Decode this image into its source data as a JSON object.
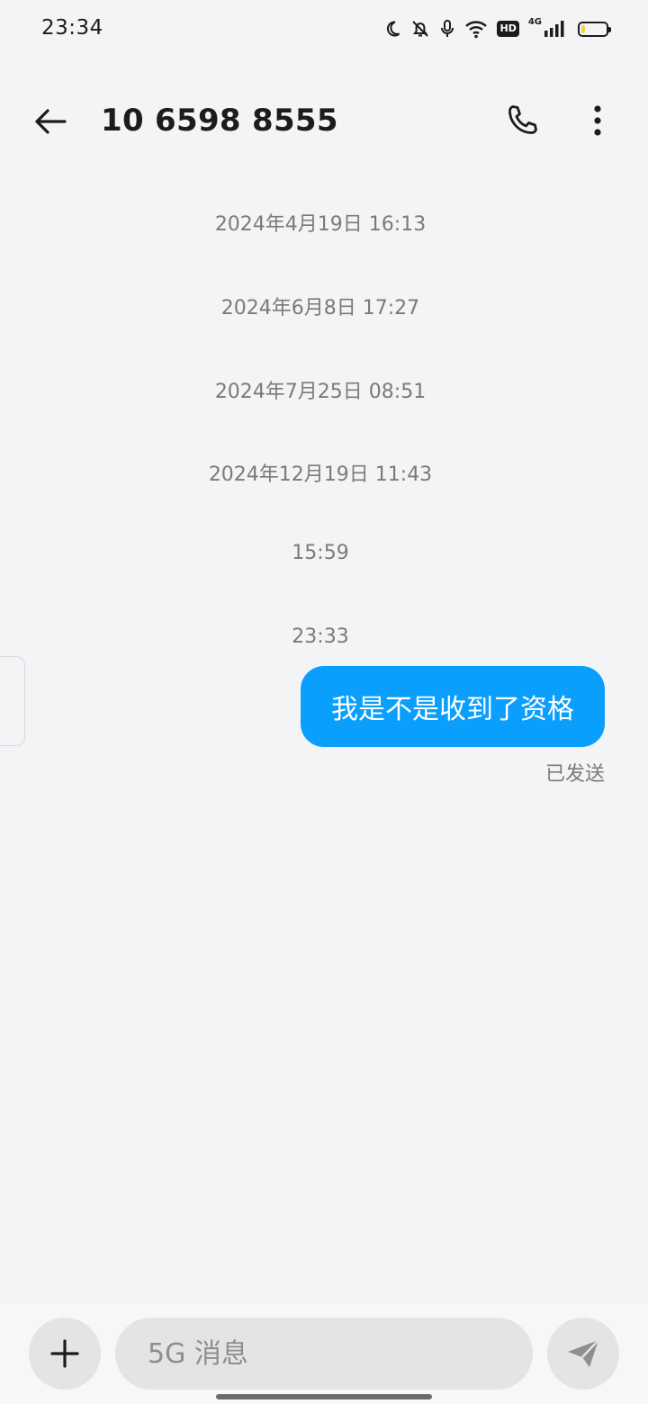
{
  "status_bar": {
    "time": "23:34",
    "network_label": "4G",
    "hd_label": "HD",
    "battery_level": 0.15,
    "icons": [
      "moon-icon",
      "bell-off-icon",
      "mic-icon",
      "wifi-icon",
      "hd-icon",
      "signal-icon",
      "battery-icon"
    ]
  },
  "header": {
    "title": "10 6598 8555",
    "icons": [
      "back-arrow-icon",
      "phone-icon",
      "more-vertical-icon"
    ]
  },
  "conversation": {
    "timestamps": [
      "2024年4月19日 16:13",
      "2024年6月8日 17:27",
      "2024年7月25日 08:51",
      "2024年12月19日 11:43",
      "15:59",
      "23:33"
    ],
    "messages": [
      {
        "direction": "sent",
        "text": "我是不是收到了资格",
        "status": "已发送"
      }
    ]
  },
  "compose": {
    "placeholder": "5G 消息",
    "value": "",
    "icons": [
      "plus-icon",
      "send-icon"
    ]
  },
  "colors": {
    "background": "#f2f4f6",
    "sent_bubble": "#0a9ffc",
    "battery_fill": "#f5d04a"
  }
}
